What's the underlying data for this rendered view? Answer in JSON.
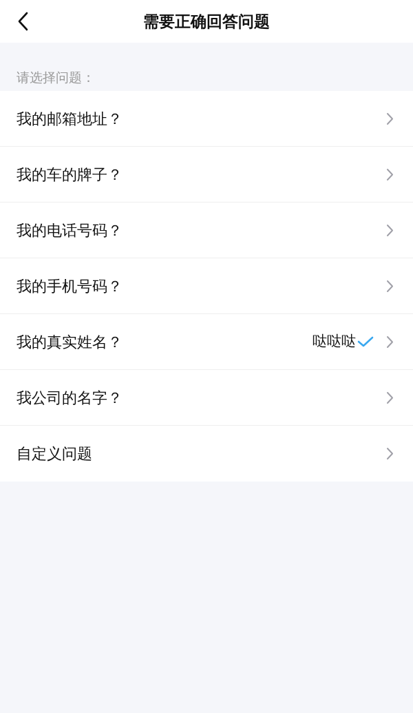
{
  "header": {
    "title": "需要正确回答问题"
  },
  "section_label": "请选择问题：",
  "questions": [
    {
      "label": "我的邮箱地址？",
      "checked": false
    },
    {
      "label": "我的车的牌子？",
      "checked": false
    },
    {
      "label": "我的电话号码？",
      "checked": false
    },
    {
      "label": "我的手机号码？",
      "checked": false
    },
    {
      "label": "我的真实姓名？",
      "answer": "哒哒哒",
      "checked": true
    },
    {
      "label": "我公司的名字？",
      "checked": false
    },
    {
      "label": "自定义问题",
      "checked": false
    }
  ]
}
